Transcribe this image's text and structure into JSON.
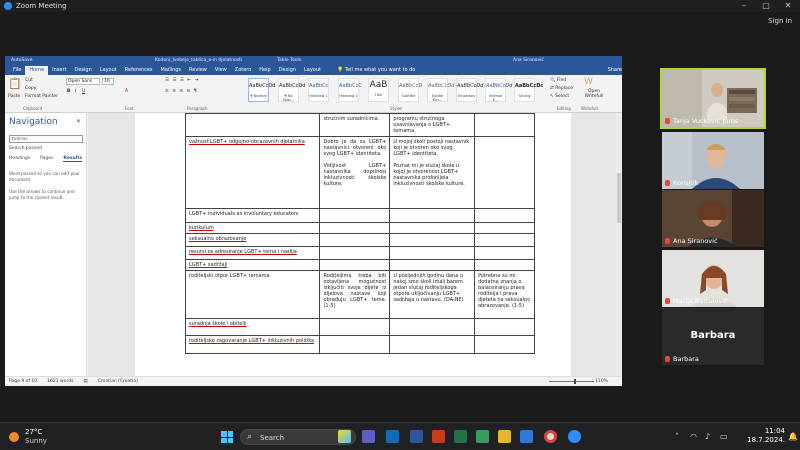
{
  "zoom": {
    "window_title": "Zoom Meeting",
    "signin": "Sign in"
  },
  "word": {
    "autosave": "AutoSave",
    "doc_title": "Kodoni_Ivebeje_tablica_o-in djelatnosti",
    "table_tools": "Table Tools",
    "user": "Ana Siranović",
    "menu": [
      "File",
      "Home",
      "Insert",
      "Design",
      "Layout",
      "References",
      "Mailings",
      "Review",
      "View",
      "Zotero",
      "Help",
      "Design",
      "Layout"
    ],
    "tell_me": "Tell me what you want to do",
    "share": "Share",
    "ribbon": {
      "paste": "Paste",
      "cut": "Cut",
      "copy": "Copy",
      "format_painter": "Format Painter",
      "clipboard": "Clipboard",
      "font_name": "Open Sans",
      "font_size": "10",
      "font_group": "Font",
      "paragraph_group": "Paragraph",
      "styles_group": "Styles",
      "editing_group": "Editing",
      "writefull_group": "Writefull",
      "find": "Find",
      "replace": "Replace",
      "select": "Select",
      "open_writefull": "Open Writefull",
      "styles": [
        {
          "sample": "AaBbCcDd",
          "name": "¶ Normal"
        },
        {
          "sample": "AaBbCcDd",
          "name": "¶ No Spac..."
        },
        {
          "sample": "AaBbCc",
          "name": "Heading 1"
        },
        {
          "sample": "AaBbCcC",
          "name": "Heading 2"
        },
        {
          "sample": "AaB",
          "name": "Title"
        },
        {
          "sample": "AaBbCcD",
          "name": "Subtitle"
        },
        {
          "sample": "AaBbCcDd",
          "name": "Subtle Em..."
        },
        {
          "sample": "AaBbCcDd",
          "name": "Emphasis"
        },
        {
          "sample": "AaBbCcDd",
          "name": "Intense E..."
        },
        {
          "sample": "AaBbCcDc",
          "name": "Strong"
        }
      ]
    },
    "nav": {
      "title": "Navigation",
      "search_value": "toleran",
      "search_passed": "Search passed",
      "tabs": [
        "Headings",
        "Pages",
        "Results"
      ],
      "msg1": "Word passed so you can edit your document.",
      "msg2": "Use the arrows to continue and jump to the closest result."
    },
    "table": {
      "row0": {
        "c2": "stručnim suradnicima.",
        "c3": "programu stručnoga usavršavanja o LGBT+ temama."
      },
      "row1": {
        "c1": "važnost LGBT+ odgojno-obrazovnih djelatnika",
        "c2a": "Dobro je da su LGBT+ nastavnici otvoreni oko svog LGBT+ identiteta.",
        "c2b": "Vidljivost LGBT+ nastavnika doprinosi inkluzivnosti školske kulture.",
        "c3a": "U mojoj školi postoji nastavnik koji je otvoren oko svog LGBT+ identiteta.",
        "c3b": "Poznat mi je slučaj škole u kojoj je otvorenost LGBT+ nastavnika pridonijela inkluzivnosti školske kulture."
      },
      "row2": "LGBT+ individuals as involuntary educators",
      "row3": "kurikulum",
      "row4": "seksualno obrazovanje",
      "row5": "resursi za adresiranje LGBT+ tema i nasilja",
      "row6": "LGBT+ sadržaji",
      "row7": {
        "c1": "roditeljski otpor LGBT+ temama",
        "c2": "Roditeljima treba biti ostavljena mogućnost isključiti svoje dijete iz dijelova nastave koji obrađuju LGBT+ teme. (1-5)",
        "c3": "U posljednjih godinu dana u našoj smo školi imali barem jedan slučaj roditeljskoga otpora uključivanju LGBT+ sadržaja u nastavu. (DA-NE)",
        "c4": "Potrebna su mi dodatna znanja o balansiranju prava roditelja i prava djeteta na seksualno obrazovanje. (1-5)"
      },
      "row8": "suradnja škole i obitelji",
      "row9": "roditeljsko zagovaranje LGBT+ inkluzivnih politika"
    },
    "status": {
      "page": "Page 9 of 10",
      "words": "1621 words",
      "lang": "Croatian (Croatia)",
      "zoom": "110%"
    }
  },
  "participants": [
    {
      "name": "Tanja Vuckovic Juros",
      "active": true
    },
    {
      "name": "Korisnik",
      "active": false
    },
    {
      "name": "Ana Siranović",
      "active": false
    },
    {
      "name": "Marija Bartulović",
      "active": false
    },
    {
      "name": "Barbara",
      "display": "Barbara",
      "active": false
    }
  ],
  "taskbar": {
    "temp": "27°C",
    "weather": "Sunny",
    "search": "Search",
    "time": "11:04",
    "date": "18.7.2024."
  }
}
